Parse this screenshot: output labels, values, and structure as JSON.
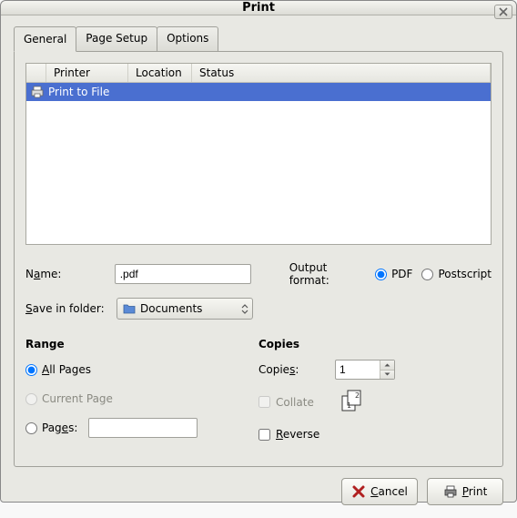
{
  "window": {
    "title": "Print"
  },
  "tabs": {
    "general": "General",
    "page_setup": "Page Setup",
    "options": "Options"
  },
  "printer_headers": {
    "printer": "Printer",
    "location": "Location",
    "status": "Status"
  },
  "printers": [
    {
      "name": "Print to File"
    }
  ],
  "form": {
    "name_label_pre": "N",
    "name_label_u": "a",
    "name_label_post": "me:",
    "name_value": ".pdf",
    "save_label_pre": "",
    "save_label_u": "S",
    "save_label_post": "ave in folder:",
    "folder": "Documents",
    "output_label": "Output format:",
    "pdf": "PDF",
    "postscript": "Postscript"
  },
  "range": {
    "title": "Range",
    "all_pages_u": "A",
    "all_pages_post": "ll Pages",
    "current_page": "Current Page",
    "pages_pre": "Pag",
    "pages_u": "e",
    "pages_post": "s:"
  },
  "copies": {
    "title": "Copies",
    "copies_pre": "Copie",
    "copies_u": "s",
    "copies_post": ":",
    "copies_value": "1",
    "collate": "Collate",
    "reverse_u": "R",
    "reverse_post": "everse"
  },
  "buttons": {
    "cancel_u": "C",
    "cancel_post": "ancel",
    "print_u": "P",
    "print_post": "rint"
  }
}
